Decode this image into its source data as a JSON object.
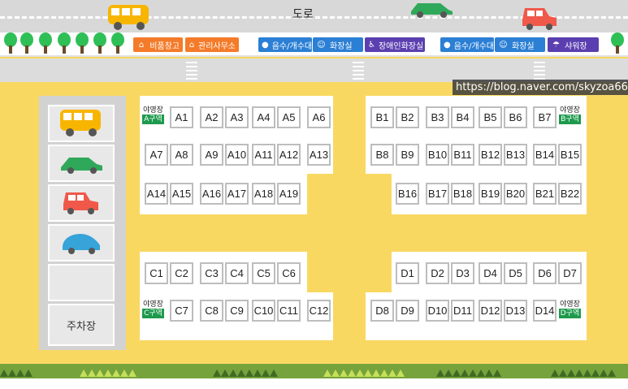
{
  "road": {
    "label": "도로"
  },
  "facilities": [
    {
      "label": "비품창고",
      "icon": "house-icon",
      "color": "#f47b2a"
    },
    {
      "label": "관리사무소",
      "icon": "house-icon",
      "color": "#f47b2a"
    },
    {
      "label": "음수/개수대",
      "icon": "water-drop-icon",
      "color": "#2b7fd4"
    },
    {
      "label": "화장실",
      "icon": "restroom-icon",
      "color": "#2b7fd4"
    },
    {
      "label": "장애인화장실",
      "icon": "wheelchair-icon",
      "color": "#5b3fb0"
    },
    {
      "label": "음수/개수대",
      "icon": "water-drop-icon",
      "color": "#2b7fd4"
    },
    {
      "label": "화장실",
      "icon": "restroom-icon",
      "color": "#2b7fd4"
    },
    {
      "label": "샤워장",
      "icon": "shower-icon",
      "color": "#5b3fb0"
    }
  ],
  "watermark": "https://blog.naver.com/skyzoa66",
  "parking": {
    "label": "주차장",
    "cars": [
      {
        "icon": "bus-icon",
        "color": "#f7b500"
      },
      {
        "icon": "car-icon",
        "color": "#2fa85a"
      },
      {
        "icon": "car-icon",
        "color": "#f0584a"
      },
      {
        "icon": "car-icon",
        "color": "#36a3d9"
      }
    ]
  },
  "zones": {
    "A": {
      "title": "야영장",
      "tag": "A구역",
      "sites": [
        "A1",
        "A2",
        "A3",
        "A4",
        "A5",
        "A6",
        "A7",
        "A8",
        "A9",
        "A10",
        "A11",
        "A12",
        "A13",
        "A14",
        "A15",
        "A16",
        "A17",
        "A18",
        "A19"
      ]
    },
    "B": {
      "title": "야영장",
      "tag": "B구역",
      "sites": [
        "B1",
        "B2",
        "B3",
        "B4",
        "B5",
        "B6",
        "B7",
        "B8",
        "B9",
        "B10",
        "B11",
        "B12",
        "B13",
        "B14",
        "B15",
        "B16",
        "B17",
        "B18",
        "B19",
        "B20",
        "B21",
        "B22"
      ]
    },
    "C": {
      "title": "야영장",
      "tag": "C구역",
      "sites": [
        "C1",
        "C2",
        "C3",
        "C4",
        "C5",
        "C6",
        "C7",
        "C8",
        "C9",
        "C10",
        "C11",
        "C12"
      ]
    },
    "D": {
      "title": "야영장",
      "tag": "D구역",
      "sites": [
        "D1",
        "D2",
        "D3",
        "D4",
        "D5",
        "D6",
        "D7",
        "D8",
        "D9",
        "D10",
        "D11",
        "D12",
        "D13",
        "D14"
      ]
    }
  },
  "colors": {
    "background": "#f9d862",
    "zone_tag": "#1d9a4c",
    "grass": "#76a33c"
  }
}
